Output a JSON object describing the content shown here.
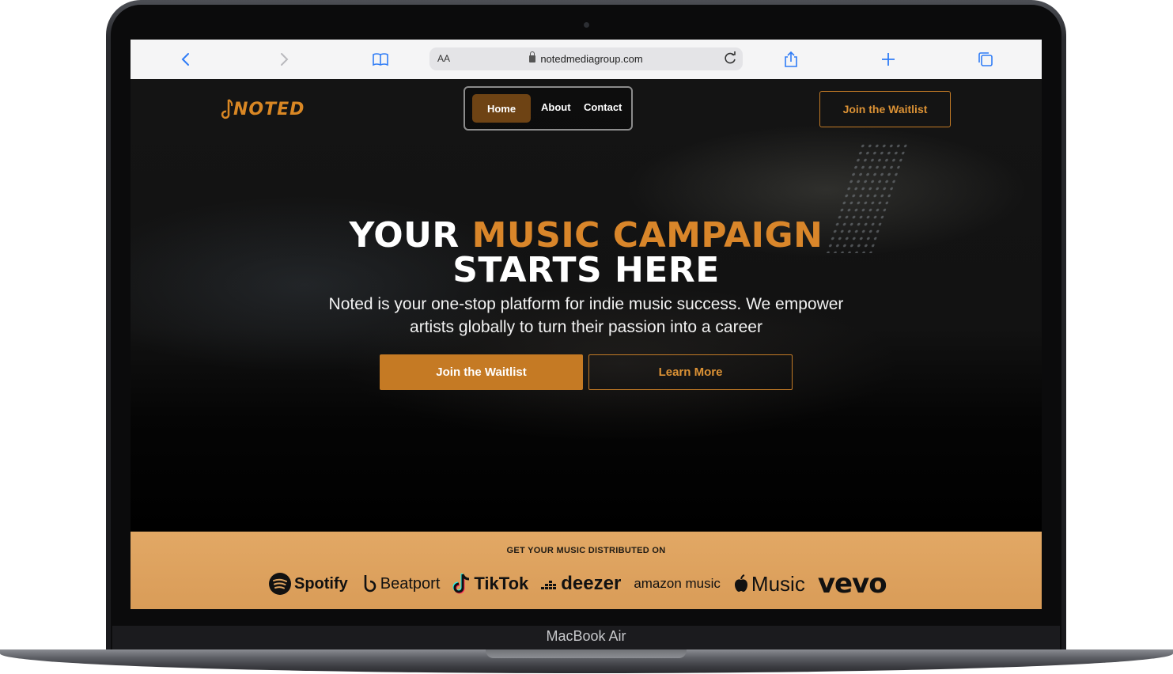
{
  "device": {
    "label": "MacBook Air"
  },
  "browser": {
    "text_size_label": "AA",
    "url": "notedmediagroup.com"
  },
  "site": {
    "logo_text": "NOTED",
    "nav": {
      "home": "Home",
      "about": "About",
      "contact": "Contact"
    },
    "header_cta": "Join the Waitlist",
    "hero": {
      "title_white_1": "YOUR ",
      "title_accent": "MUSIC CAMPAIGN",
      "title_line2": "STARTS HERE",
      "subtitle": "Noted is your one-stop platform for indie music success. We empower artists globally to turn their passion into a career",
      "primary_cta": "Join the Waitlist",
      "secondary_cta": "Learn More"
    },
    "distribution": {
      "title": "GET YOUR MUSIC DISTRIBUTED ON",
      "platforms": [
        "Spotify",
        "Beatport",
        "TikTok",
        "deezer",
        "amazon music",
        "Music",
        "vevo"
      ]
    }
  },
  "colors": {
    "accent": "#d9862a",
    "nav_active": "#6e4314",
    "distribution_band": "#dea461"
  }
}
